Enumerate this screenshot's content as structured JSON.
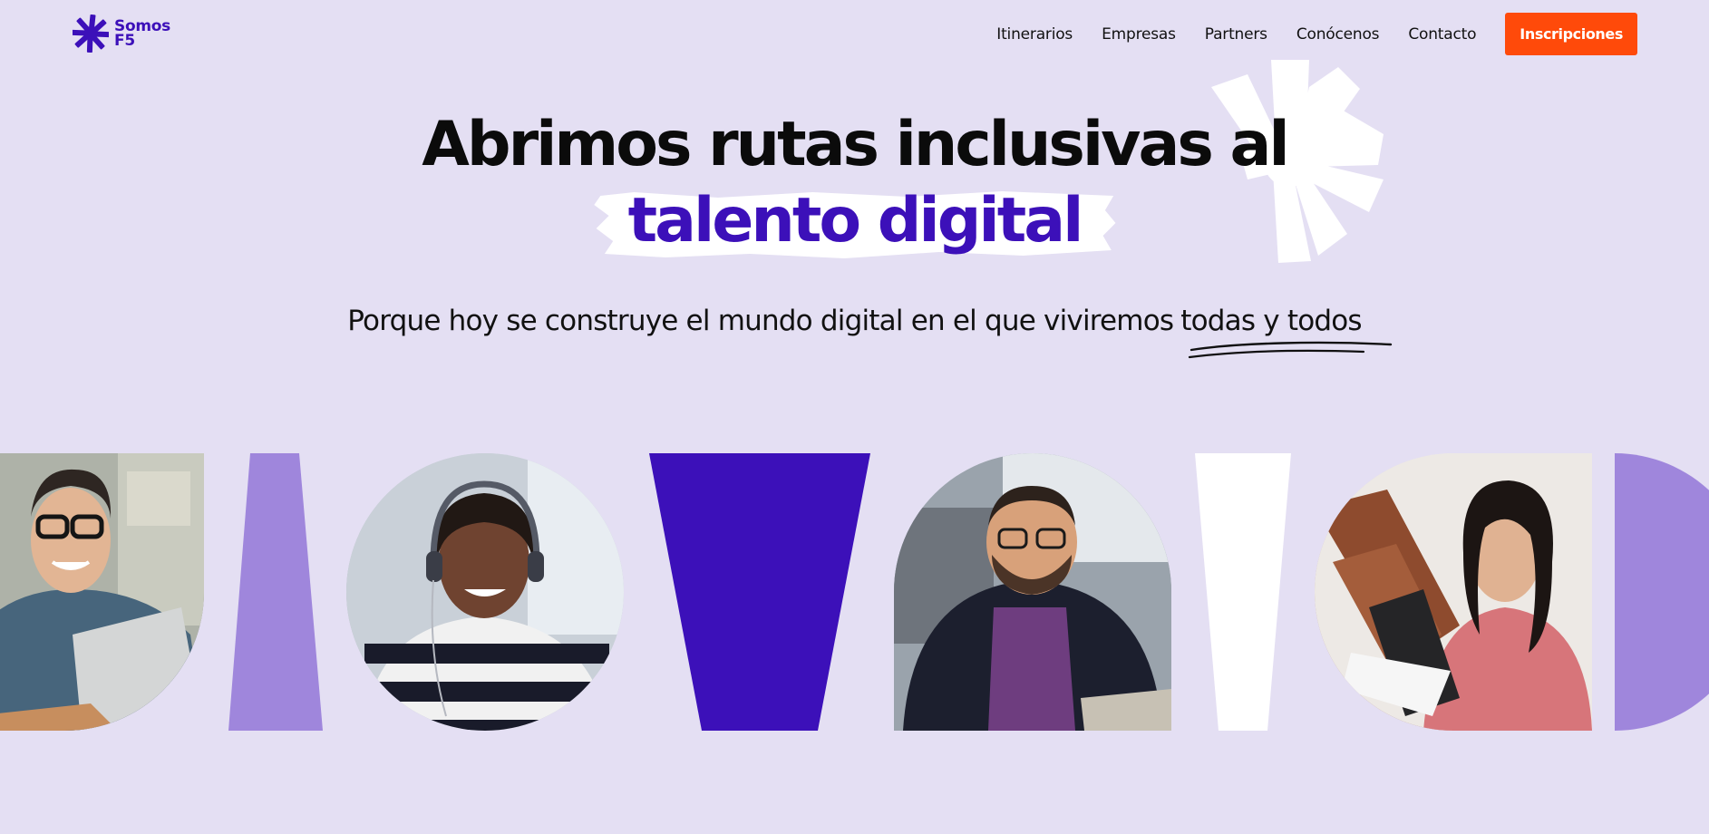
{
  "brand": {
    "logo_text": "Somos F5",
    "colors": {
      "primary": "#3c10b9",
      "accent": "#ff4a0a",
      "background": "#e4dff3",
      "lilac": "#9f86dc"
    }
  },
  "nav": {
    "items": [
      {
        "label": "Itinerarios"
      },
      {
        "label": "Empresas"
      },
      {
        "label": "Partners"
      },
      {
        "label": "Conócenos"
      },
      {
        "label": "Contacto"
      }
    ],
    "cta_label": "Inscripciones"
  },
  "hero": {
    "title_line1": "Abrimos rutas inclusivas al",
    "title_line2": "talento digital",
    "subtitle_main": "Porque hoy se construye el mundo digital en el que viviremos",
    "subtitle_highlight": "todas y todos"
  },
  "gallery": {
    "items": [
      {
        "kind": "photo",
        "icon": "person-man-glasses-laptop"
      },
      {
        "kind": "shape",
        "icon": "trapezoid-lilac"
      },
      {
        "kind": "photo",
        "icon": "person-woman-headset"
      },
      {
        "kind": "shape",
        "icon": "trapezoid-purple"
      },
      {
        "kind": "photo",
        "icon": "person-man-laptop"
      },
      {
        "kind": "shape",
        "icon": "trapezoid-white"
      },
      {
        "kind": "photo",
        "icon": "person-woman-reading"
      },
      {
        "kind": "shape",
        "icon": "half-circle-lilac"
      }
    ]
  }
}
